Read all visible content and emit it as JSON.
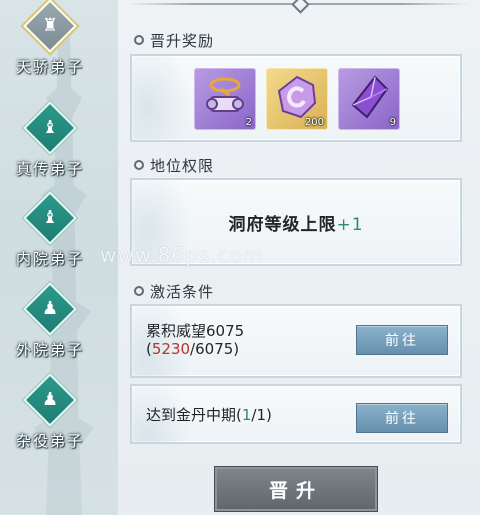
{
  "ranks": [
    {
      "label": "天骄弟子",
      "icon": "sect-disciple-emblem-icon",
      "active": true
    },
    {
      "label": "真传弟子",
      "icon": "sect-disciple-emblem-icon"
    },
    {
      "label": "内院弟子",
      "icon": "sect-disciple-emblem-icon"
    },
    {
      "label": "外院弟子",
      "icon": "sect-disciple-emblem-icon"
    },
    {
      "label": "杂役弟子",
      "icon": "sect-disciple-emblem-icon"
    }
  ],
  "sections": {
    "rewards_title": "晋升奖励",
    "privileges_title": "地位权限",
    "conditions_title": "激活条件"
  },
  "rewards": [
    {
      "icon": "scroll-item-icon",
      "count": "2",
      "rarity": "purple"
    },
    {
      "icon": "jade-token-icon",
      "count": "200",
      "rarity": "gold"
    },
    {
      "icon": "purple-crystal-icon",
      "count": "9",
      "rarity": "purple"
    }
  ],
  "privilege": {
    "text": "洞府等级上限",
    "bonus": "+1"
  },
  "conditions": [
    {
      "text": "累积威望6075",
      "open": "(",
      "current": "5230",
      "sep": "/",
      "required": "6075",
      "close": ")",
      "button": "前往"
    },
    {
      "text": "达到金丹中期",
      "open": "(",
      "current": "1",
      "sep": "/",
      "required": "1",
      "close": ")",
      "button": "前往"
    }
  ],
  "promote_button": "晋升",
  "watermark": "www.86ps.com",
  "colors": {
    "accent_teal": "#2d8a78",
    "deficit_red": "#b8332b",
    "button_blue": "#6690ae"
  }
}
